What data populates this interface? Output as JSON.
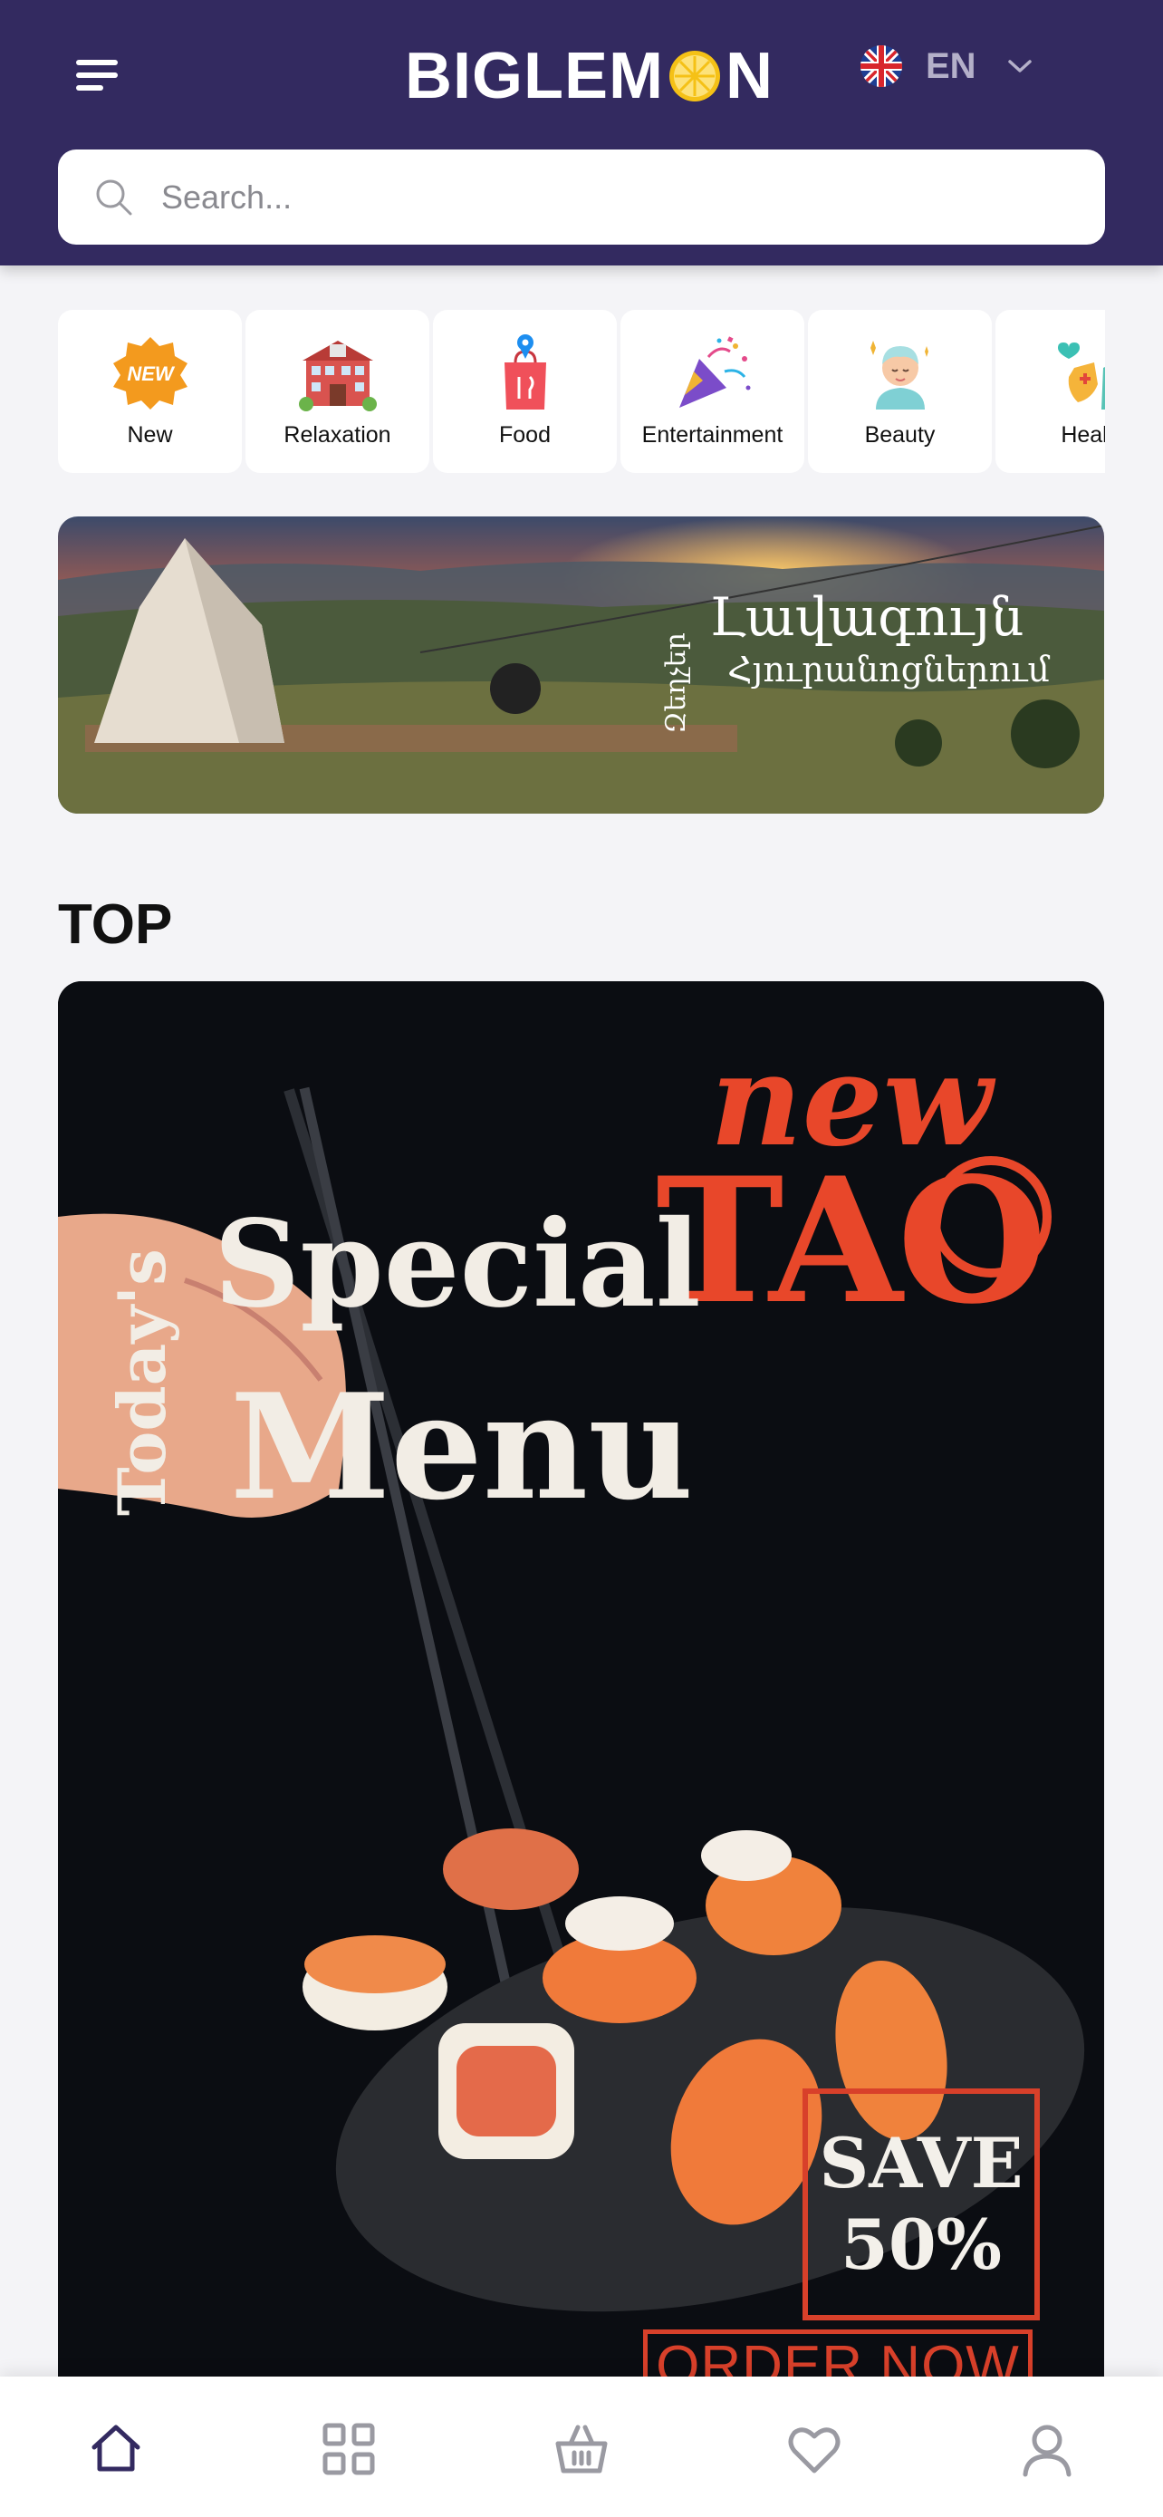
{
  "header": {
    "logo": {
      "part1": "BIGLEM",
      "part2": "N"
    },
    "language": {
      "code": "EN",
      "flag": "uk-flag-icon"
    },
    "colors": {
      "background": "#332a60",
      "accent": "#f5c116"
    }
  },
  "search": {
    "placeholder": "Search..."
  },
  "categories": [
    {
      "label": "New",
      "icon": "new-badge-icon"
    },
    {
      "label": "Relaxation",
      "icon": "hotel-icon"
    },
    {
      "label": "Food",
      "icon": "food-bag-icon"
    },
    {
      "label": "Entertainment",
      "icon": "party-popper-icon"
    },
    {
      "label": "Beauty",
      "icon": "beauty-face-icon"
    },
    {
      "label": "Healt",
      "icon": "health-icon"
    }
  ],
  "banner": {
    "line1": "Լավագույն",
    "line2": "Հյուրանոցներում",
    "side": "Զեղչեր"
  },
  "top": {
    "title": "TOP",
    "promo": {
      "todays": "Today's",
      "special": "Special",
      "menu": "Menu",
      "new": "new",
      "tao": "TAO",
      "save_line1": "SAVE",
      "save_line2": "50%",
      "order": "ORDER NOW"
    }
  },
  "bottom_nav": [
    {
      "name": "home-icon",
      "active": true
    },
    {
      "name": "grid-icon",
      "active": false
    },
    {
      "name": "basket-icon",
      "active": false
    },
    {
      "name": "heart-icon",
      "active": false
    },
    {
      "name": "profile-icon",
      "active": false
    }
  ]
}
